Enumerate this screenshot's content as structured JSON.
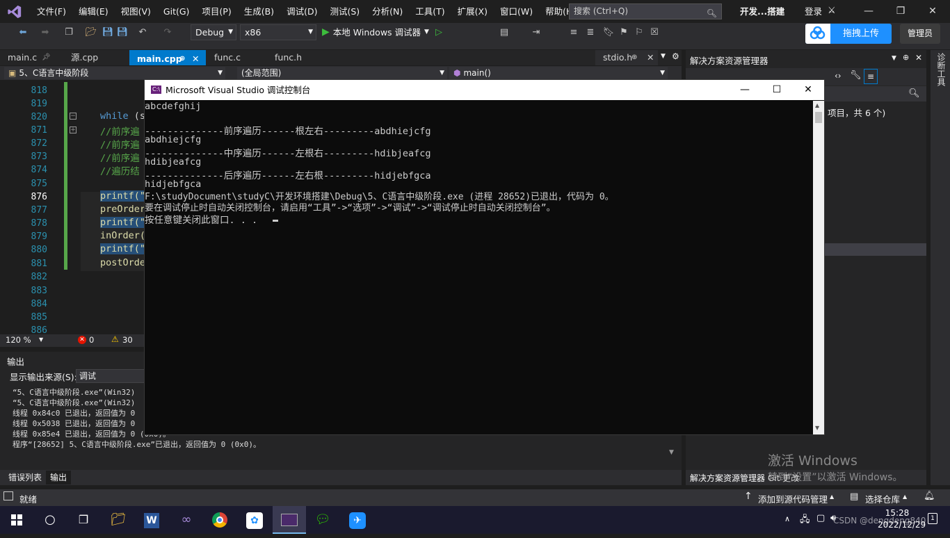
{
  "menubar": {
    "menus": [
      "文件(F)",
      "编辑(E)",
      "视图(V)",
      "Git(G)",
      "项目(P)",
      "生成(B)",
      "调试(D)",
      "测试(S)",
      "分析(N)",
      "工具(T)",
      "扩展(X)",
      "窗口(W)",
      "帮助(H)"
    ],
    "search_placeholder": "搜索 (Ctrl+Q)",
    "solution_name": "开发...搭建",
    "login": "登录"
  },
  "toolbar": {
    "config": "Debug",
    "platform": "x86",
    "run_label": "本地 Windows 调试器",
    "upload_label": "拖拽上传",
    "admin_label": "管理员"
  },
  "tabs": [
    "main.c",
    "源.cpp",
    "main.cpp",
    "func.c",
    "func.h",
    "stdio.h"
  ],
  "navbar": {
    "project": "5、C语言中级阶段",
    "scope": "(全局范围)",
    "member": "main()"
  },
  "code": {
    "line_numbers": [
      "818",
      "819",
      "820",
      "871",
      "872",
      "873",
      "874",
      "875",
      "876",
      "877",
      "878",
      "879",
      "880",
      "881",
      "882",
      "883",
      "884",
      "885",
      "886"
    ],
    "lines": {
      "l820_kw": "while",
      "l820_rest": " (s",
      "l871": "//前序遍",
      "l872": "//前序遍",
      "l873": "//前序遍",
      "l874": "//遍历结",
      "l876": "printf(\"",
      "l877": "preOrder",
      "l878": "printf(\"",
      "l879": "inOrder(",
      "l880": "printf(\"",
      "l881": "postOrde"
    }
  },
  "editor_status": {
    "zoom": "120 %",
    "errors": "0",
    "warnings": "30"
  },
  "output": {
    "title": "输出",
    "source_label": "显示输出来源(S):",
    "source_value": "调试",
    "lines": [
      "“5、C语言中级阶段.exe”(Win32)",
      "“5、C语言中级阶段.exe”(Win32)",
      "线程 0x84c0 已退出，返回值为 0",
      "线程 0x5038 已退出，返回值为 0",
      "线程 0x85e4 已退出，返回值为 0 (0x0)。",
      "程序“[28652] 5、C语言中级阶段.exe”已退出，返回值为 0 (0x0)。"
    ],
    "tabs": [
      "错误列表",
      "输出"
    ]
  },
  "solution_explorer": {
    "title": "解决方案资源管理器",
    "summary": "项目，共 6 个)",
    "footer_tabs": [
      "解决方案资源管理器",
      "Git 更改"
    ]
  },
  "side_tool": "诊断工具",
  "console": {
    "title": "Microsoft Visual Studio 调试控制台",
    "lines": [
      "abcdefghij",
      "",
      "--------------前序遍历------根左右---------abdhiejcfg",
      "abdhiejcfg",
      "--------------中序遍历------左根右---------hdibjeafcg",
      "hdibjeafcg",
      "--------------后序遍历------左右根---------hidjebfgca",
      "hidjebfgca",
      "F:\\studyDocument\\studyC\\开发环境搭建\\Debug\\5、C语言中级阶段.exe (进程 28652)已退出，代码为 0。",
      "要在调试停止时自动关闭控制台，请启用“工具”->“选项”->“调试”->“调试停止时自动关闭控制台”。",
      "按任意键关闭此窗口. . ."
    ]
  },
  "watermark": {
    "line1": "激活 Windows",
    "line2": "转到“设置”以激活 Windows。"
  },
  "statusbar": {
    "ready": "就绪",
    "add_source": "添加到源代码管理",
    "select_repo": "选择仓库"
  },
  "taskbar": {
    "time": "15:28",
    "date": "2022/12/29",
    "tray_text": "CSDN @dengdeng840"
  }
}
